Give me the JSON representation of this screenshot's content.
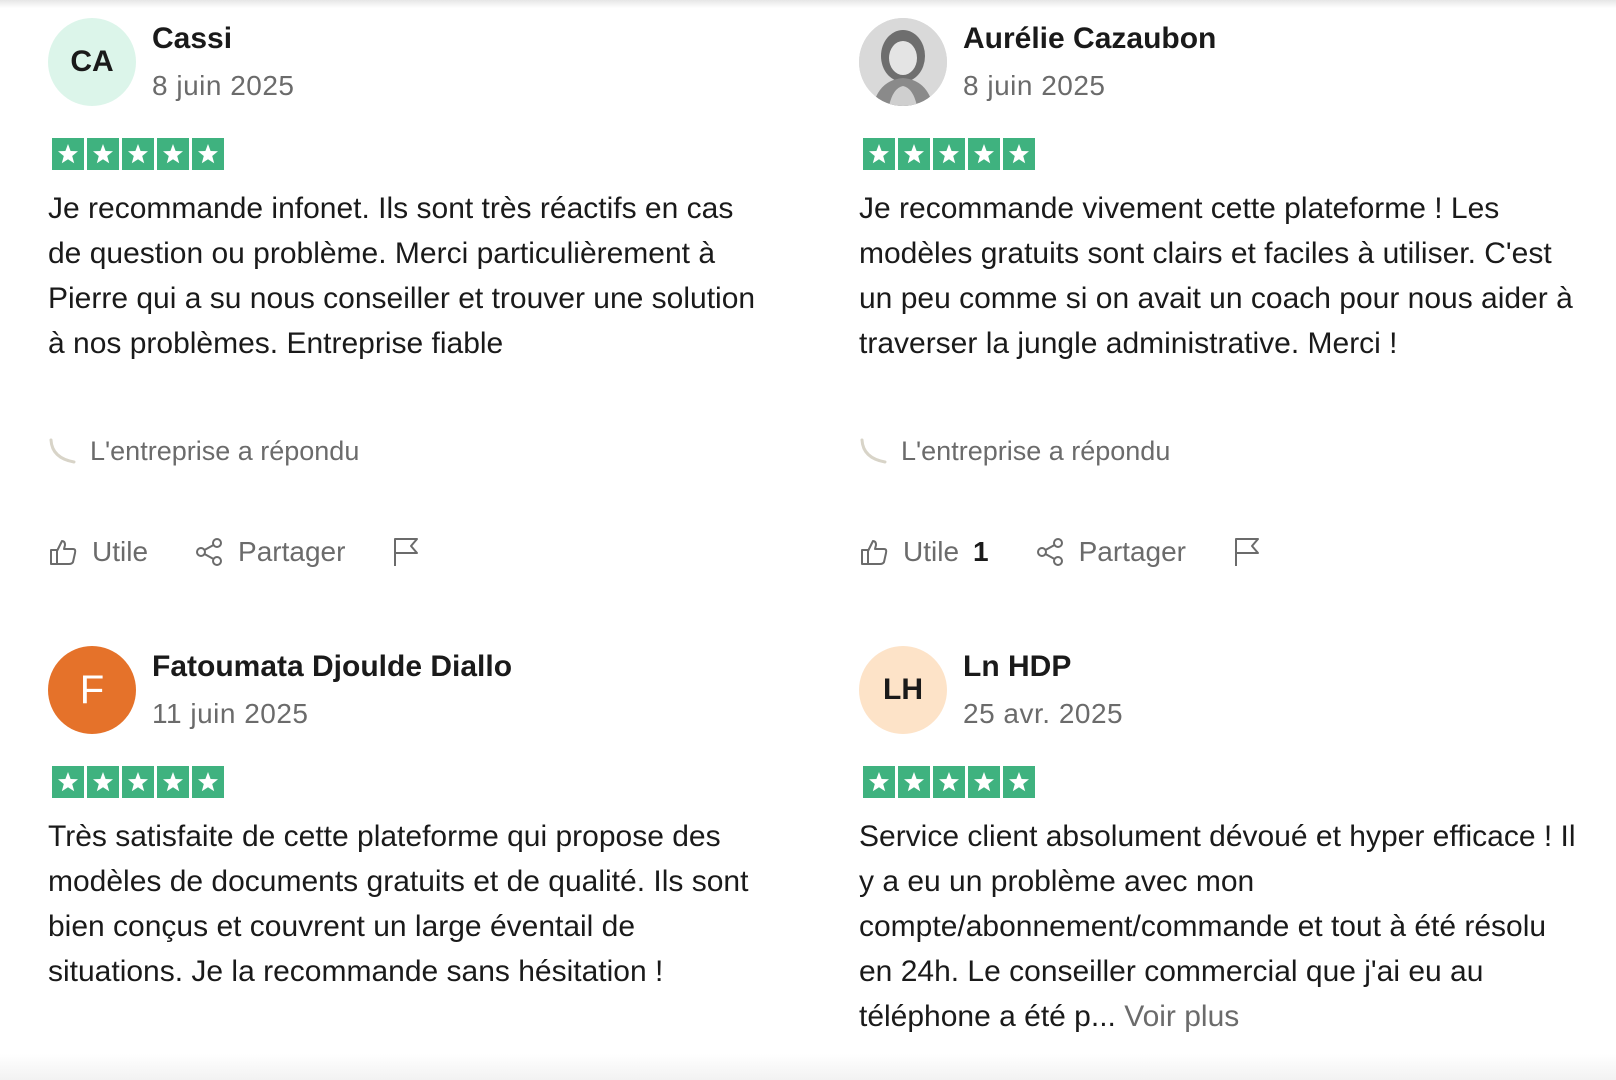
{
  "reviews": [
    {
      "avatar_initials": "CA",
      "name": "Cassi",
      "date": "8 juin 2025",
      "rating": 5,
      "text": "Je recommande infonet. Ils sont très réactifs en cas de question ou problème. Merci particulièrement à Pierre qui a su nous conseiller et trouver une solution à nos problèmes. Entreprise fiable",
      "company_reply": "L'entreprise a répondu",
      "useful_label": "Utile",
      "useful_count": "",
      "share_label": "Partager"
    },
    {
      "avatar_initials": "",
      "name": "Aurélie Cazaubon",
      "date": "8 juin 2025",
      "rating": 5,
      "text": "Je recommande vivement cette plateforme ! Les modèles gratuits sont clairs et faciles à utiliser. C'est un peu comme si on avait un coach pour nous aider à traverser la jungle administrative. Merci !",
      "company_reply": "L'entreprise a répondu",
      "useful_label": "Utile",
      "useful_count": "1",
      "share_label": "Partager"
    },
    {
      "avatar_initials": "F",
      "name": "Fatoumata Djoulde Diallo",
      "date": "11 juin 2025",
      "rating": 5,
      "text": "Très satisfaite de cette plateforme qui propose des modèles de documents gratuits et de qualité. Ils sont bien conçus et couvrent un large éventail de situations. Je la recommande sans hésitation !"
    },
    {
      "avatar_initials": "LH",
      "name": "Ln HDP",
      "date": "25 avr. 2025",
      "rating": 5,
      "text": "Service client absolument dévoué et hyper efficace ! Il y a eu un problème avec mon compte/abonnement/commande et tout à été résolu en 24h. Le conseiller commercial que j'ai eu au téléphone a été p...",
      "more_label": "Voir plus"
    }
  ],
  "colors": {
    "star_green": "#3fb27f",
    "avatar_mint": "#dcf5ea",
    "avatar_orange": "#e5722a",
    "avatar_peach": "#fde3c8",
    "muted_text": "#6b6b6b"
  },
  "icons": [
    "star-icon",
    "reply-curve-icon",
    "thumbs-up-icon",
    "share-icon",
    "flag-icon"
  ]
}
